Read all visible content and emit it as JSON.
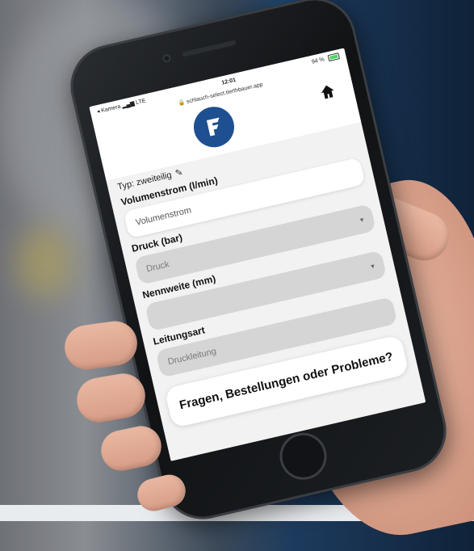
{
  "status_bar": {
    "carrier": "◂ Kamera",
    "network": "LTE",
    "time": "12:01",
    "battery": "94 %"
  },
  "url": "schlauch-select.tierthbauer.app",
  "header": {
    "home_icon": "home-icon",
    "logo_icon": "brand-logo-icon"
  },
  "form": {
    "type_label": "Typ: zweiteilig",
    "volume_label": "Volumenstrom (l/min)",
    "volume_placeholder": "Volumenstrom",
    "pressure_label": "Druck (bar)",
    "pressure_placeholder": "Druck",
    "diameter_label": "Nennweite (mm)",
    "diameter_value": "",
    "line_label": "Leitungsart",
    "line_value": "Druckleitung"
  },
  "help": {
    "title": "Fragen, Bestellungen oder Probleme?"
  },
  "colors": {
    "brand_blue": "#1d4f91",
    "input_gray": "#d5d5d5"
  }
}
